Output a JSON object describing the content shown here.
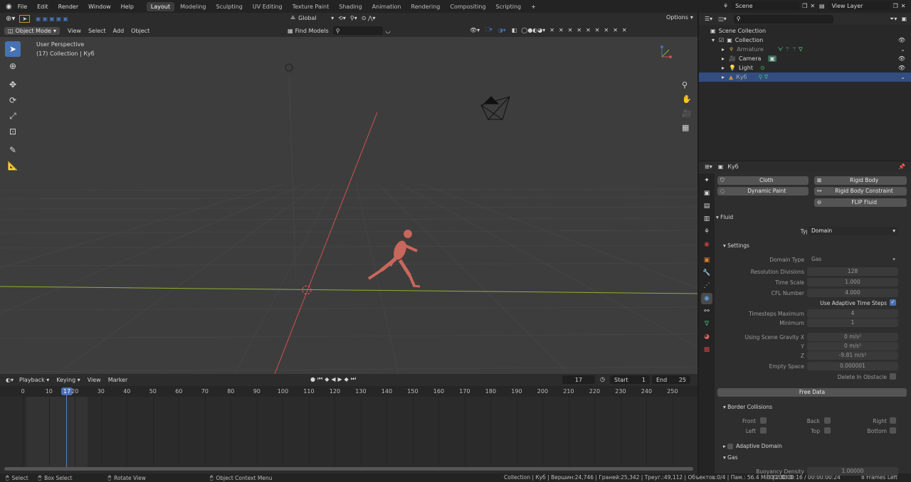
{
  "menu": [
    "File",
    "Edit",
    "Render",
    "Window",
    "Help"
  ],
  "workspaces": [
    "Layout",
    "Modeling",
    "Sculpting",
    "UV Editing",
    "Texture Paint",
    "Shading",
    "Animation",
    "Rendering",
    "Compositing",
    "Scripting"
  ],
  "active_workspace": "Layout",
  "scene_name": "Scene",
  "view_layer": "View Layer",
  "viewport": {
    "mode": "Object Mode",
    "menus": [
      "View",
      "Select",
      "Add",
      "Object"
    ],
    "transform_orientation": "Global",
    "find_models": "Find Models",
    "options": "Options",
    "perspective": "User Perspective",
    "collection_info": "(17) Collection | Куб"
  },
  "timeline": {
    "menus": [
      "Playback",
      "Keying",
      "View",
      "Marker"
    ],
    "current_frame": "17",
    "start_label": "Start",
    "start": "1",
    "end_label": "End",
    "end": "25",
    "ticks": [
      "0",
      "10",
      "20",
      "30",
      "40",
      "50",
      "60",
      "70",
      "80",
      "90",
      "100",
      "110",
      "120",
      "130",
      "140",
      "150",
      "160",
      "170",
      "180",
      "190",
      "200",
      "210",
      "220",
      "230",
      "240",
      "250"
    ]
  },
  "status": {
    "select": "Select",
    "box_select": "Box Select",
    "rotate_view": "Rotate View",
    "context_menu": "Object Context Menu",
    "stats": "Collection | Куб | Вершин:24,746 | Граней:25,342 | Треуг.:49,112 | Объектов:0/4 | Пам.: 56.4 MiB | 2.83.0",
    "time": "00:00:00:16 / 00:00:00:24",
    "frames_left": "8 Frames Left"
  },
  "outliner": {
    "root": "Scene Collection",
    "collection": "Collection",
    "items": [
      "Armature",
      "Camera",
      "Light",
      "Куб"
    ]
  },
  "properties": {
    "object_name": "Куб",
    "physics_buttons": [
      "Cloth",
      "Rigid Body",
      "Dynamic Paint",
      "Rigid Body Constraint",
      "FLIP Fluid"
    ],
    "fluid_section": "Fluid",
    "type_label": "Type",
    "type_value": "Domain",
    "settings_section": "Settings",
    "domain_type_label": "Domain Type",
    "domain_type_value": "Gas",
    "resolution_label": "Resolution Divisions",
    "resolution_value": "128",
    "time_scale_label": "Time Scale",
    "time_scale_value": "1.000",
    "cfl_label": "CFL Number",
    "cfl_value": "4.000",
    "adaptive_label": "Use Adaptive Time Steps",
    "timesteps_max_label": "Timesteps Maximum",
    "timesteps_max_value": "4",
    "minimum_label": "Minimum",
    "minimum_value": "1",
    "gravity_x_label": "Using Scene Gravity X",
    "gravity_x_value": "0 m/s²",
    "gravity_y_label": "Y",
    "gravity_y_value": "0 m/s²",
    "gravity_z_label": "Z",
    "gravity_z_value": "-9.81 m/s²",
    "empty_space_label": "Empty Space",
    "empty_space_value": "0.000001",
    "delete_obstacle_label": "Delete In Obstacle",
    "free_data": "Free Data",
    "border_section": "Border Collisions",
    "front": "Front",
    "back": "Back",
    "right": "Right",
    "left": "Left",
    "top": "Top",
    "bottom": "Bottom",
    "adaptive_domain": "Adaptive Domain",
    "gas_section": "Gas",
    "buoyancy_label": "Buoyancy Density",
    "buoyancy_value": "1.00000"
  },
  "colors": {
    "accent": "#4772b3",
    "x_axis": "#d05050",
    "y_axis": "#8fb030",
    "character": "#c8675c"
  }
}
